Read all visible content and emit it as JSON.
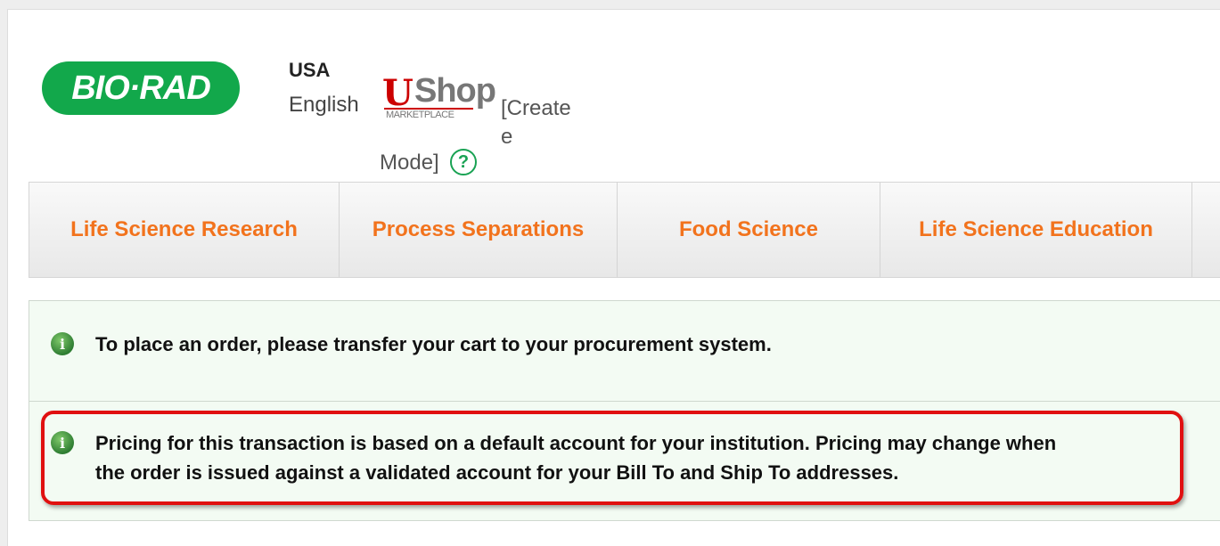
{
  "header": {
    "logo_text": "BIO·RAD",
    "country": "USA",
    "language": "English",
    "marketplace_logo": {
      "u": "U",
      "shop": "Shop",
      "sub": "MARKETPLACE"
    },
    "mode_label_part1": "[Create",
    "mode_label_part2": "e",
    "mode_label_part3": "Mode]",
    "help_icon_glyph": "?"
  },
  "nav": {
    "items": [
      {
        "label": "Life Science Research"
      },
      {
        "label": "Process Separations"
      },
      {
        "label": "Food Science"
      },
      {
        "label": "Life Science Education"
      },
      {
        "label": ""
      }
    ]
  },
  "messages": [
    {
      "icon": "info-icon",
      "text": "To place an order, please transfer your cart to your procurement system."
    },
    {
      "icon": "info-icon",
      "line1": "Pricing for this transaction is based on a default account for your institution. Pricing may change when",
      "line2": "the order is issued against a validated account for your Bill To and Ship To addresses."
    }
  ],
  "colors": {
    "brand_green": "#12a84b",
    "nav_orange": "#f2731d",
    "highlight_red": "#e01010",
    "message_bg": "#f3fbf3"
  }
}
